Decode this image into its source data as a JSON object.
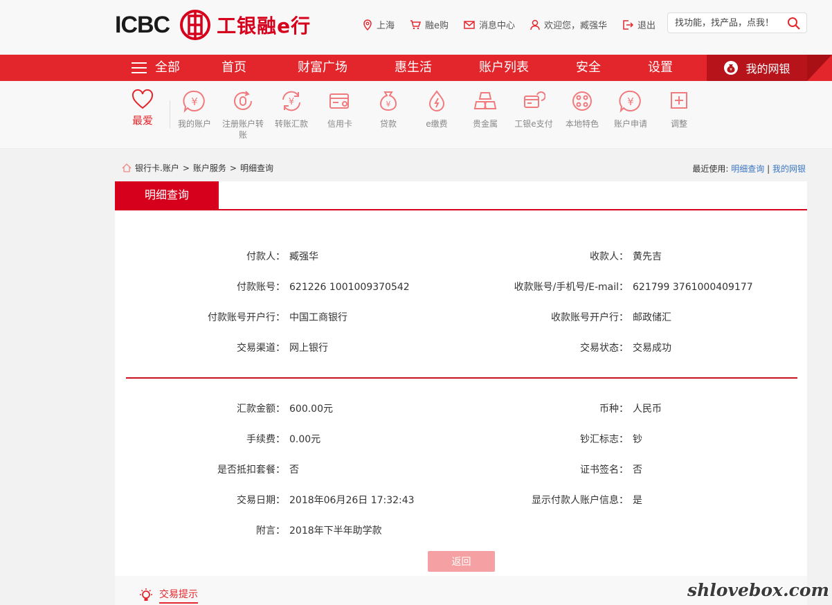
{
  "header": {
    "logo_en": "ICBC",
    "logo_cn": "工银融e行",
    "links": [
      {
        "icon": "location-icon",
        "label": "上海"
      },
      {
        "icon": "cart-icon",
        "label": "融e购"
      },
      {
        "icon": "mail-icon",
        "label": "消息中心"
      },
      {
        "icon": "user-icon",
        "label": "欢迎您，臧强华"
      },
      {
        "icon": "logout-icon",
        "label": "退出"
      }
    ],
    "search_placeholder": "找功能，找产品，点我！"
  },
  "nav": {
    "items": [
      "全部",
      "首页",
      "财富广场",
      "惠生活",
      "账户列表",
      "安全",
      "设置"
    ],
    "my_bank": "我的网银"
  },
  "shortcuts": {
    "favorite": "最爱",
    "items": [
      {
        "icon": "yuan-circle-icon",
        "label": "我的账户"
      },
      {
        "icon": "register-icon",
        "label": "注册账户转账"
      },
      {
        "icon": "transfer-icon",
        "label": "转账汇款"
      },
      {
        "icon": "credit-card-icon",
        "label": "信用卡"
      },
      {
        "icon": "money-bag-icon",
        "label": "贷款"
      },
      {
        "icon": "drop-icon",
        "label": "e缴费"
      },
      {
        "icon": "gold-icon",
        "label": "贵金属"
      },
      {
        "icon": "epay-icon",
        "label": "工银e支付"
      },
      {
        "icon": "local-icon",
        "label": "本地特色"
      },
      {
        "icon": "apply-icon",
        "label": "账户申请"
      },
      {
        "icon": "plus-square-icon",
        "label": "调整"
      }
    ]
  },
  "breadcrumb": [
    "银行卡.账户",
    "账户服务",
    "明细查询"
  ],
  "recent": {
    "label": "最近使用:",
    "links": [
      "明细查询",
      "我的网银"
    ]
  },
  "panel": {
    "tab": "明细查询",
    "section1": [
      {
        "l_label": "付款人：",
        "l_value": "臧强华",
        "r_label": "收款人：",
        "r_value": "黄先吉"
      },
      {
        "l_label": "付款账号：",
        "l_value": "621226 1001009370542",
        "r_label": "收款账号/手机号/E-mail：",
        "r_value": "621799 3761000409177"
      },
      {
        "l_label": "付款账号开户行：",
        "l_value": "中国工商银行",
        "r_label": "收款账号开户行：",
        "r_value": "邮政储汇"
      },
      {
        "l_label": "交易渠道：",
        "l_value": "网上银行",
        "r_label": "交易状态：",
        "r_value": "交易成功"
      }
    ],
    "section2": [
      {
        "l_label": "汇款金额：",
        "l_value": "600.00元",
        "r_label": "币种：",
        "r_value": "人民币"
      },
      {
        "l_label": "手续费：",
        "l_value": "0.00元",
        "r_label": "钞汇标志：",
        "r_value": "钞"
      },
      {
        "l_label": "是否抵扣套餐：",
        "l_value": "否",
        "r_label": "证书签名：",
        "r_value": "否"
      },
      {
        "l_label": "交易日期：",
        "l_value": "2018年06月26日 17:32:43",
        "r_label": "显示付款人账户信息：",
        "r_value": "是"
      },
      {
        "l_label": "附言：",
        "l_value": "2018年下半年助学款",
        "r_label": "",
        "r_value": ""
      }
    ],
    "back_button": "返回",
    "hint": "交易提示"
  },
  "watermark": "shlovebox.com",
  "colors": {
    "brand_red": "#e3262c",
    "dark_red": "#b7131a",
    "link_blue": "#3a75c4"
  }
}
